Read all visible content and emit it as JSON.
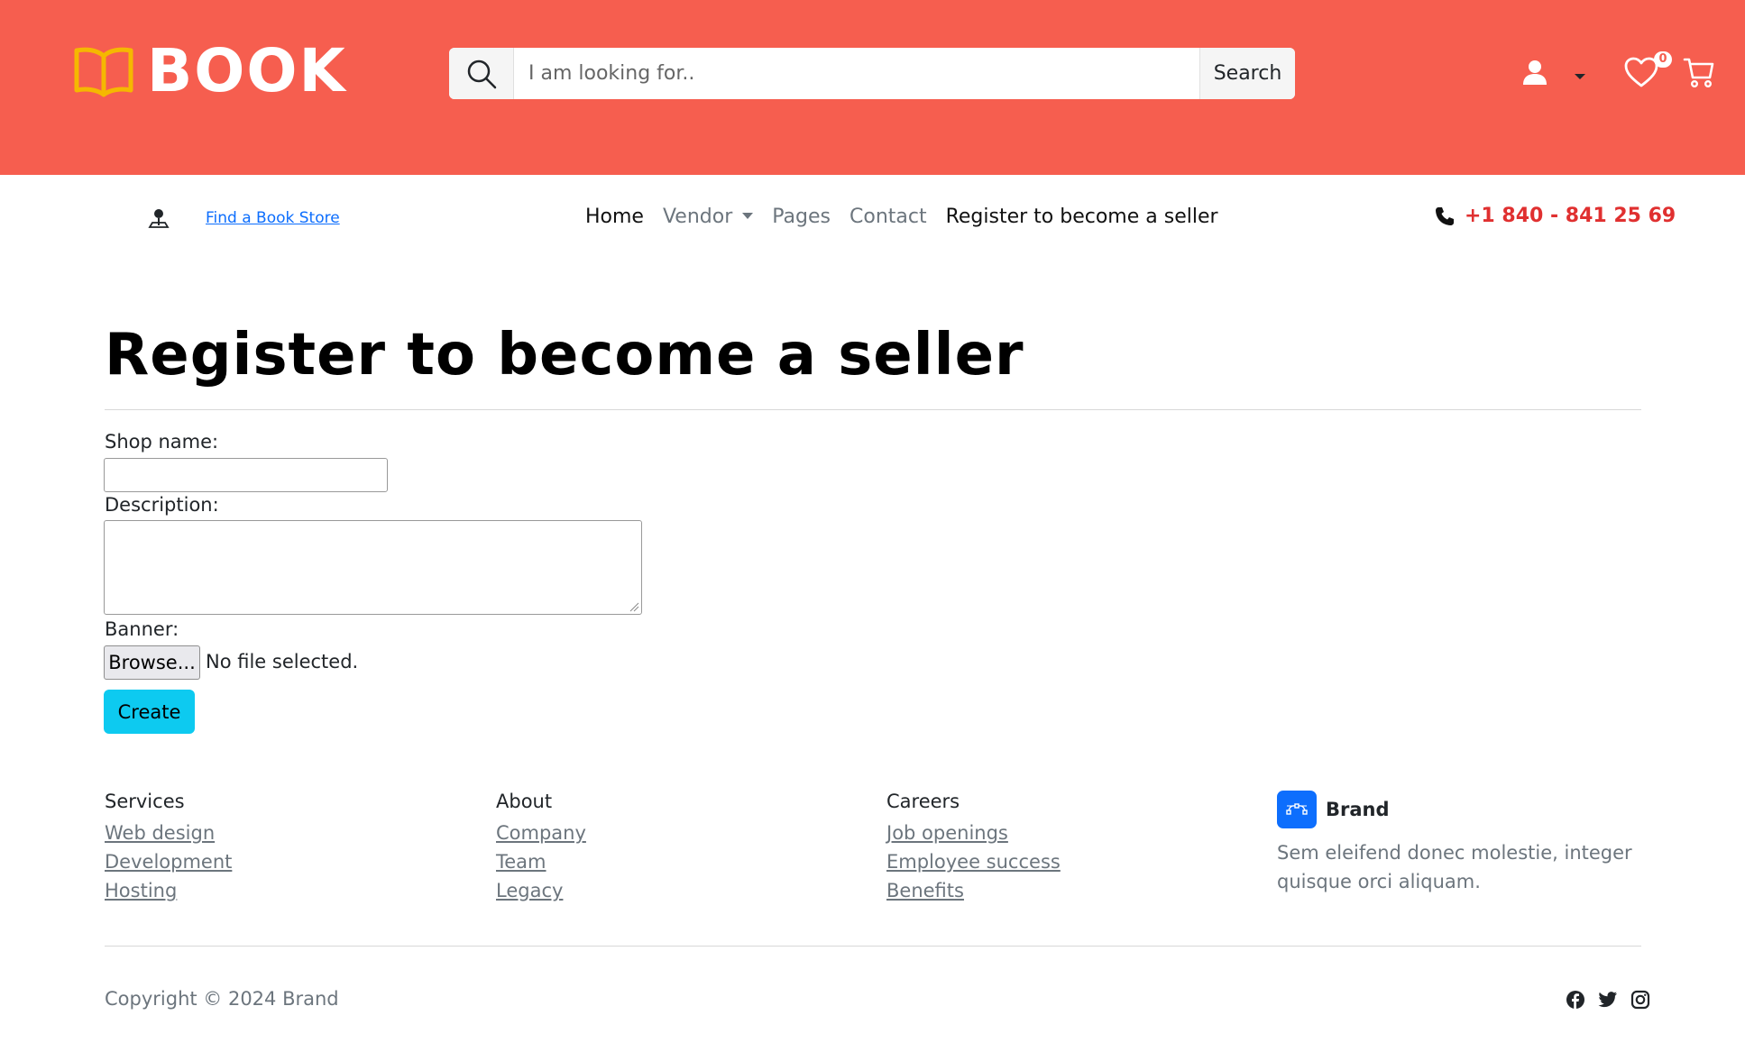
{
  "header": {
    "logo_text": "BOOK",
    "search": {
      "placeholder": "I am looking for..",
      "button_label": "Search"
    },
    "wishlist_count": "0",
    "colors": {
      "header_bg": "#f65e4f",
      "logo_icon": "#f5b800"
    },
    "icons": [
      "book-icon",
      "search-icon",
      "user-icon",
      "chevron-down-icon",
      "heart-icon",
      "cart-icon"
    ]
  },
  "nav": {
    "store_link": "Find a Book Store",
    "menu": [
      {
        "label": "Home"
      },
      {
        "label": "Vendor"
      },
      {
        "label": "Pages"
      },
      {
        "label": "Contact"
      },
      {
        "label": "Register to become a seller"
      }
    ],
    "phone": "+1 840 - 841 25 69",
    "colors": {
      "phone": "#e03030",
      "link": "#0d6efd"
    }
  },
  "main": {
    "title": "Register to become a seller",
    "form": {
      "shop_name_label": "Shop name:",
      "shop_name_value": "",
      "description_label": "Description:",
      "description_value": "",
      "banner_label": "Banner:",
      "browse_label": "Browse...",
      "no_file_text": "No file selected.",
      "create_label": "Create"
    },
    "colors": {
      "create_button": "#0dcaf0"
    }
  },
  "footer": {
    "columns": [
      {
        "title": "Services",
        "links": [
          "Web design",
          "Development",
          "Hosting"
        ]
      },
      {
        "title": "About",
        "links": [
          "Company",
          "Team",
          "Legacy"
        ]
      },
      {
        "title": "Careers",
        "links": [
          "Job openings",
          "Employee success",
          "Benefits"
        ]
      }
    ],
    "brand": {
      "name": "Brand",
      "description": "Sem eleifend donec molestie, integer quisque orci aliquam."
    },
    "copyright": "Copyright © 2024 Brand",
    "socials": [
      "facebook-icon",
      "twitter-icon",
      "instagram-icon"
    ],
    "colors": {
      "brand_icon_bg": "#0d6efd"
    }
  }
}
